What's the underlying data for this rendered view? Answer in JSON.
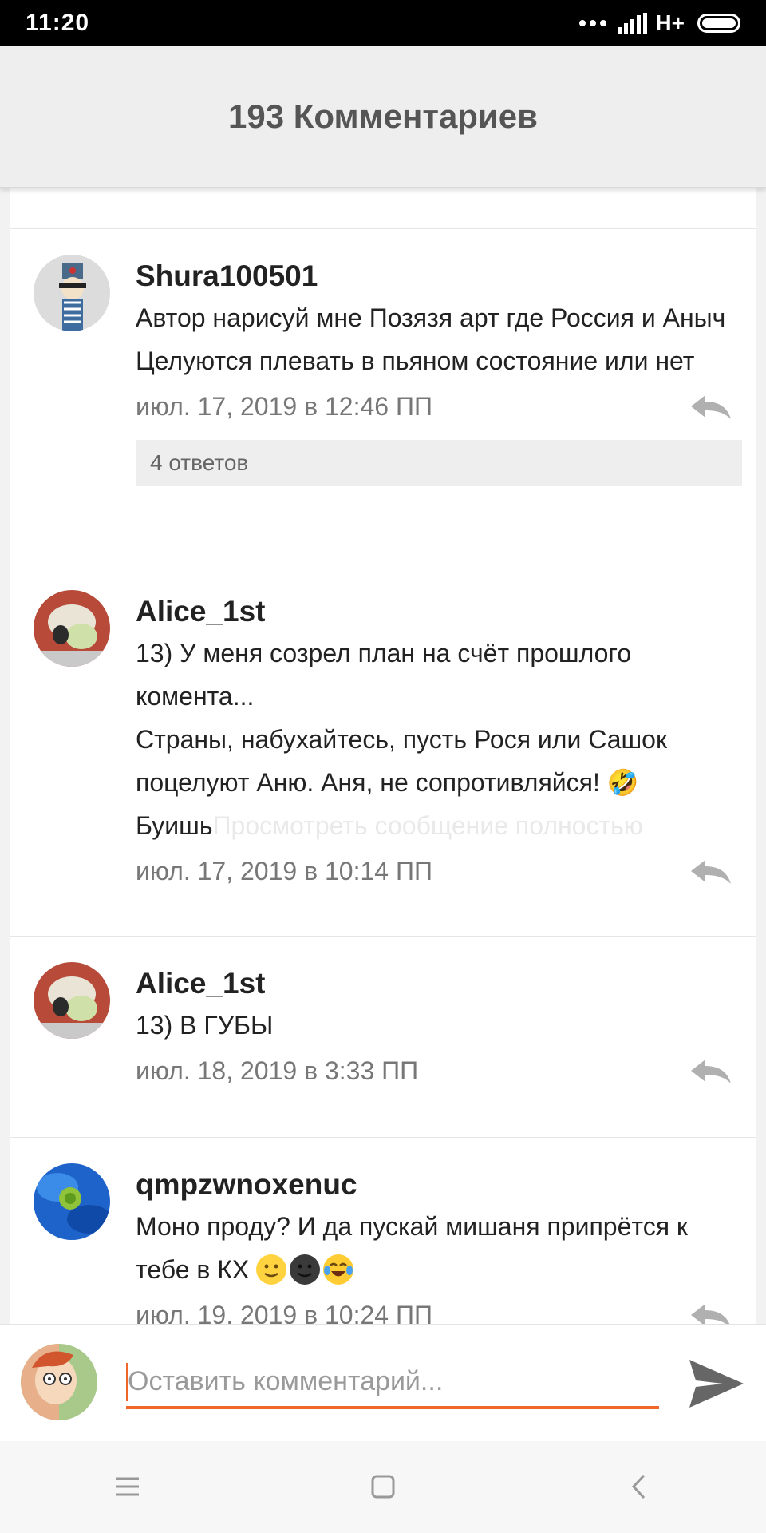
{
  "status_bar": {
    "time": "11:20",
    "network": "H+"
  },
  "header": {
    "title": "193 Комментариев"
  },
  "comments": [
    {
      "username": "Shura100501",
      "text": "Автор нарисуй мне Позязя арт где Россия и Аныч Целуются плевать в пьяном состояние или нет",
      "date": "июл. 17, 2019 в 12:46 ПП",
      "replies": "4 ответов"
    },
    {
      "username": "Alice_1st",
      "text_lines": [
        "13) У меня созрел план на счёт прошлого комента...",
        "Страны, набухайтесь, пусть Рося или Сашок поцелуют Аню. Аня, не сопротивляйся! 🤣"
      ],
      "text_tail": "Буишь",
      "more_link": "Просмотреть сообщение полностью",
      "date": "июл. 17, 2019 в 10:14 ПП"
    },
    {
      "username": "Alice_1st",
      "text": "13) В ГУБЫ",
      "date": "июл. 18, 2019 в 3:33 ПП"
    },
    {
      "username": "qmpzwnoxenuc",
      "text": "Моно проду? И да пускай мишаня припрётся к тебе в КХ",
      "emojis": [
        "slightly-smiling-face",
        "dark-smiling-face",
        "tears-of-joy-face"
      ],
      "date": "июл. 19, 2019 в 10:24 ПП"
    }
  ],
  "composer": {
    "placeholder": "Оставить комментарий..."
  },
  "colors": {
    "accent": "#f0672a",
    "header_bg": "#eeeeee",
    "text": "#222222",
    "muted": "#777777"
  },
  "icons": {
    "reply": "reply-arrow-icon",
    "send": "send-icon",
    "nav": [
      "menu-icon",
      "home-icon",
      "back-icon"
    ]
  }
}
